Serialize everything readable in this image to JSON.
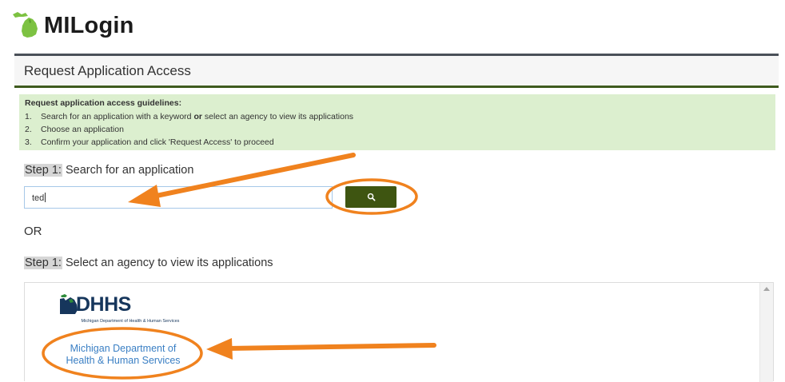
{
  "header": {
    "logo_text": "MILogin"
  },
  "page": {
    "title": "Request Application Access"
  },
  "guidelines": {
    "title": "Request application access guidelines:",
    "items": [
      {
        "num": "1.",
        "before": "Search for an application with a keyword ",
        "bold": "or",
        "after": " select an agency to view its applications"
      },
      {
        "num": "2.",
        "before": "Choose an application",
        "bold": "",
        "after": ""
      },
      {
        "num": "3.",
        "before": "Confirm your application and click 'Request Access' to proceed",
        "bold": "",
        "after": ""
      }
    ]
  },
  "search_step": {
    "tag": "Step 1:",
    "text": " Search for an application",
    "input_value": "ted",
    "button_icon": "search-icon"
  },
  "or_text": "OR",
  "agency_step": {
    "tag": "Step 1:",
    "text": " Select an agency to view its applications"
  },
  "agencies": [
    {
      "logo_word": "DHHS",
      "logo_sub": "Michigan Department of Health & Human Services",
      "link_line1": "Michigan Department of",
      "link_line2": "Health & Human Services"
    }
  ],
  "colors": {
    "annotation_orange": "#f0821e",
    "search_button": "#3e5511",
    "guideline_bg": "#dcefcf",
    "link": "#3a7fc4",
    "brand_green": "#7dc242"
  }
}
